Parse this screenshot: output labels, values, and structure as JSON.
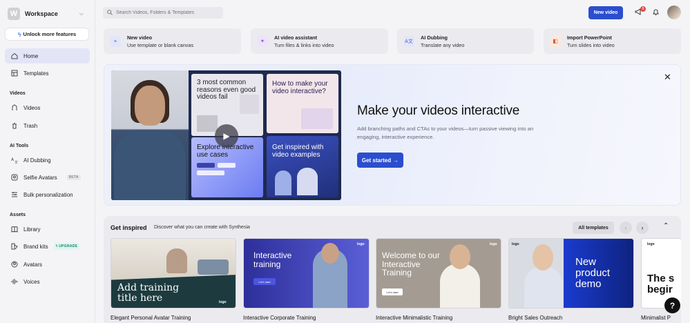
{
  "workspace": {
    "initial": "W",
    "name": "Workspace"
  },
  "unlock_label": "Unlock more features",
  "nav": {
    "home": "Home",
    "templates": "Templates",
    "section_videos": "Videos",
    "videos": "Videos",
    "trash": "Trash",
    "section_ai_tools": "AI Tools",
    "ai_dubbing": "AI Dubbing",
    "selfie_avatars": "Selfie Avatars",
    "beta": "BETA",
    "bulk": "Bulk personalization",
    "section_assets": "Assets",
    "library": "Library",
    "brand_kits": "Brand kits",
    "upgrade": "UPGRADE",
    "avatars": "Avatars",
    "voices": "Voices"
  },
  "search": {
    "placeholder": "Search Videos, Folders & Templates"
  },
  "topbar": {
    "new_video": "New video",
    "notif_count": "8"
  },
  "quick_actions": [
    {
      "title": "New video",
      "subtitle": "Use template or blank canvas",
      "icon": "plus-icon",
      "color": "#e3e6f8"
    },
    {
      "title": "AI video assistant",
      "subtitle": "Turn files & links into video",
      "icon": "sparkle-icon",
      "color": "#ece3f8"
    },
    {
      "title": "AI Dubbing",
      "subtitle": "Translate any video",
      "icon": "translate-icon",
      "color": "#e3e6f8"
    },
    {
      "title": "Import PowerPoint",
      "subtitle": "Turn slides into video",
      "icon": "powerpoint-icon",
      "color": "#fbe7df"
    }
  ],
  "hero": {
    "thumb1": "3 most common reasons even good videos fail",
    "thumb2": "How to make your video interactive?",
    "thumb3": "Explore interactive use cases",
    "thumb4": "Get inspired with video examples",
    "title": "Make your videos interactive",
    "description": "Add branching paths and CTAs to your videos—turn passive viewing into an engaging, interactive experience.",
    "cta": "Get started"
  },
  "inspired": {
    "title": "Get inspired",
    "subtitle": "Discover what you can create with Synthesia",
    "all_templates": "All templates",
    "cards": [
      {
        "overlay": "Add training title here",
        "caption": "Elegant Personal Avatar Training"
      },
      {
        "overlay": "Interactive training",
        "button": "Let's start",
        "caption": "Interactive Corporate Training"
      },
      {
        "overlay": "Welcome to our Interactive Training",
        "button": "Let's start",
        "caption": "Interactive Minimalistic Training"
      },
      {
        "overlay": "New product demo",
        "caption": "Bright Sales Outreach"
      },
      {
        "overlay": "The s begir",
        "caption": "Minimalist P"
      }
    ],
    "logo_text": "logo"
  },
  "help": "?"
}
